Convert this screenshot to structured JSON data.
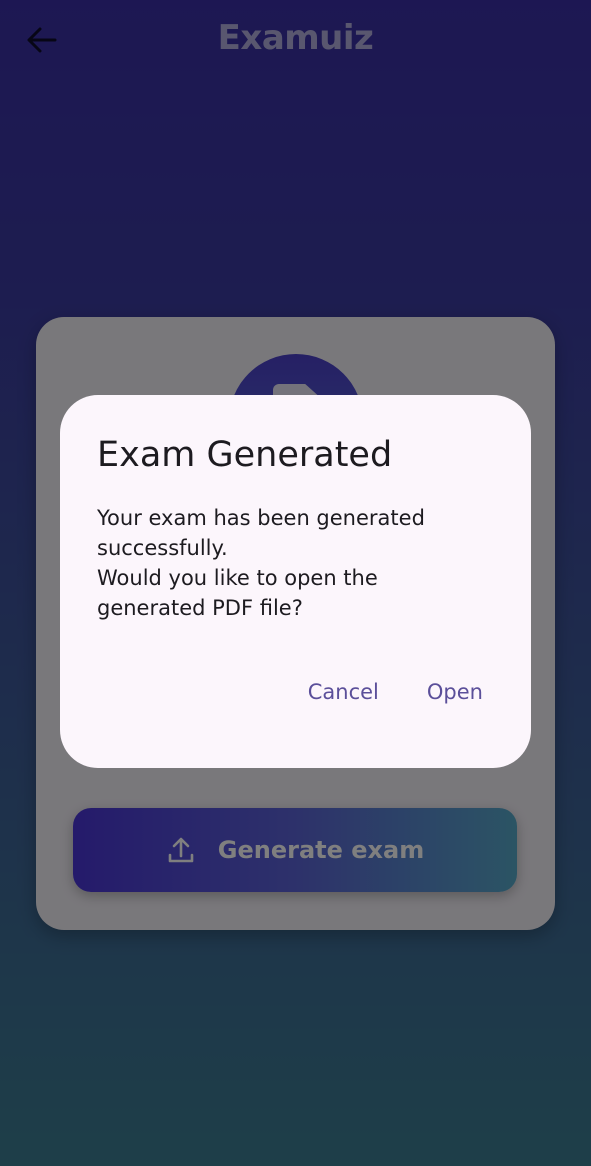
{
  "appbar": {
    "title": "Examuiz",
    "back_icon": "arrow-left-icon"
  },
  "card": {
    "document_icon": "document-icon",
    "generate_button": {
      "label": "Generate exam",
      "icon": "upload-icon"
    }
  },
  "dialog": {
    "title": "Exam Generated",
    "body_lines": [
      "Your exam has been generated",
      "successfully.",
      "Would you like to open the",
      "generated PDF file?"
    ],
    "cancel_label": "Cancel",
    "open_label": "Open"
  },
  "colors": {
    "gradient_top": "#3a2fa6",
    "gradient_bottom": "#3d7e92",
    "dialog_background": "#fcf6fc",
    "dialog_action": "#5b4f9a"
  }
}
